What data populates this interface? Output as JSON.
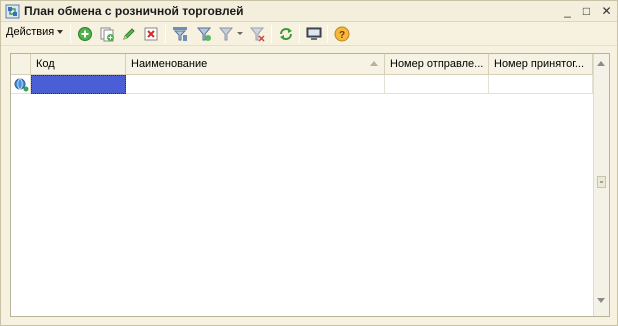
{
  "window": {
    "title": "План обмена с розничной торговлей",
    "controls": {
      "minimize": "_",
      "maximize": "□",
      "close": "✕"
    }
  },
  "toolbar": {
    "actions_label": "Действия",
    "buttons": [
      {
        "name": "add-button",
        "icon": "add-icon"
      },
      {
        "name": "copy-button",
        "icon": "copy-icon"
      },
      {
        "name": "edit-button",
        "icon": "pencil-icon"
      },
      {
        "name": "delete-button",
        "icon": "delete-icon"
      },
      {
        "name": "filter-set-button",
        "icon": "filter-set-icon"
      },
      {
        "name": "filter-by-value-button",
        "icon": "filter-icon"
      },
      {
        "name": "filter-history-button",
        "icon": "filter-dropdown-icon"
      },
      {
        "name": "filter-off-button",
        "icon": "filter-off-icon"
      },
      {
        "name": "refresh-button",
        "icon": "refresh-icon"
      },
      {
        "name": "list-settings-button",
        "icon": "monitor-icon"
      },
      {
        "name": "help-button",
        "icon": "help-icon",
        "label": "?"
      }
    ]
  },
  "table": {
    "columns": [
      {
        "label": "Код"
      },
      {
        "label": "Наименование"
      },
      {
        "label": "Номер отправле..."
      },
      {
        "label": "Номер принятог..."
      }
    ],
    "sorted_column": "Наименование",
    "rows": [
      {
        "icon": "exchange-node-icon",
        "cells": [
          "",
          "",
          "",
          ""
        ],
        "selected_cell": 0
      }
    ]
  },
  "colors": {
    "selection": "#4a5fd6",
    "window_background": "#f7f1df"
  }
}
